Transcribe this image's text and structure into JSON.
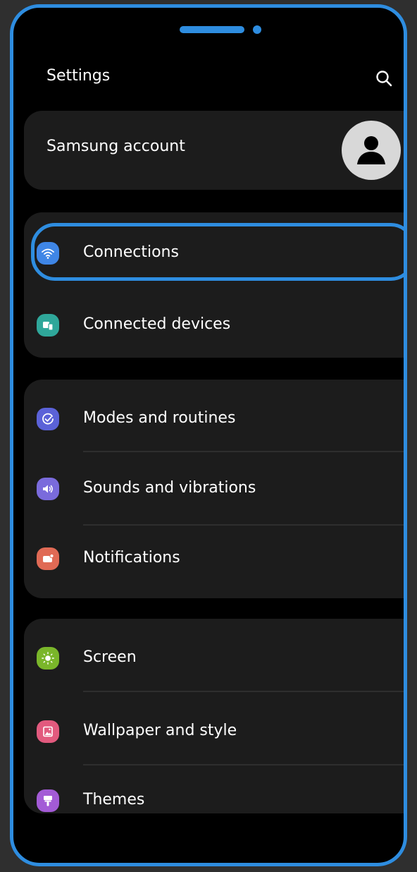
{
  "header": {
    "title": "Settings",
    "search_icon": "search-icon"
  },
  "account": {
    "label": "Samsung account",
    "avatar_icon": "person-icon"
  },
  "groups": [
    {
      "items": [
        {
          "label": "Connections",
          "icon": "wifi-icon",
          "icon_color": "#3f86e6",
          "highlighted": true
        },
        {
          "label": "Connected devices",
          "icon": "devices-icon",
          "icon_color": "#2fa79a"
        }
      ]
    },
    {
      "items": [
        {
          "label": "Modes and routines",
          "icon": "check-circle-icon",
          "icon_color": "#5b62d8"
        },
        {
          "label": "Sounds and vibrations",
          "icon": "speaker-icon",
          "icon_color": "#7a6bdc"
        },
        {
          "label": "Notifications",
          "icon": "notification-icon",
          "icon_color": "#e06a55"
        }
      ]
    },
    {
      "items": [
        {
          "label": "Screen",
          "icon": "sun-icon",
          "icon_color": "#7ab62a"
        },
        {
          "label": "Wallpaper and style",
          "icon": "image-icon",
          "icon_color": "#e25a7e"
        },
        {
          "label": "Themes",
          "icon": "brush-icon",
          "icon_color": "#a35bd6"
        }
      ]
    }
  ],
  "colors": {
    "accent": "#2e8de0",
    "background": "#000000",
    "card": "#1c1c1c"
  }
}
